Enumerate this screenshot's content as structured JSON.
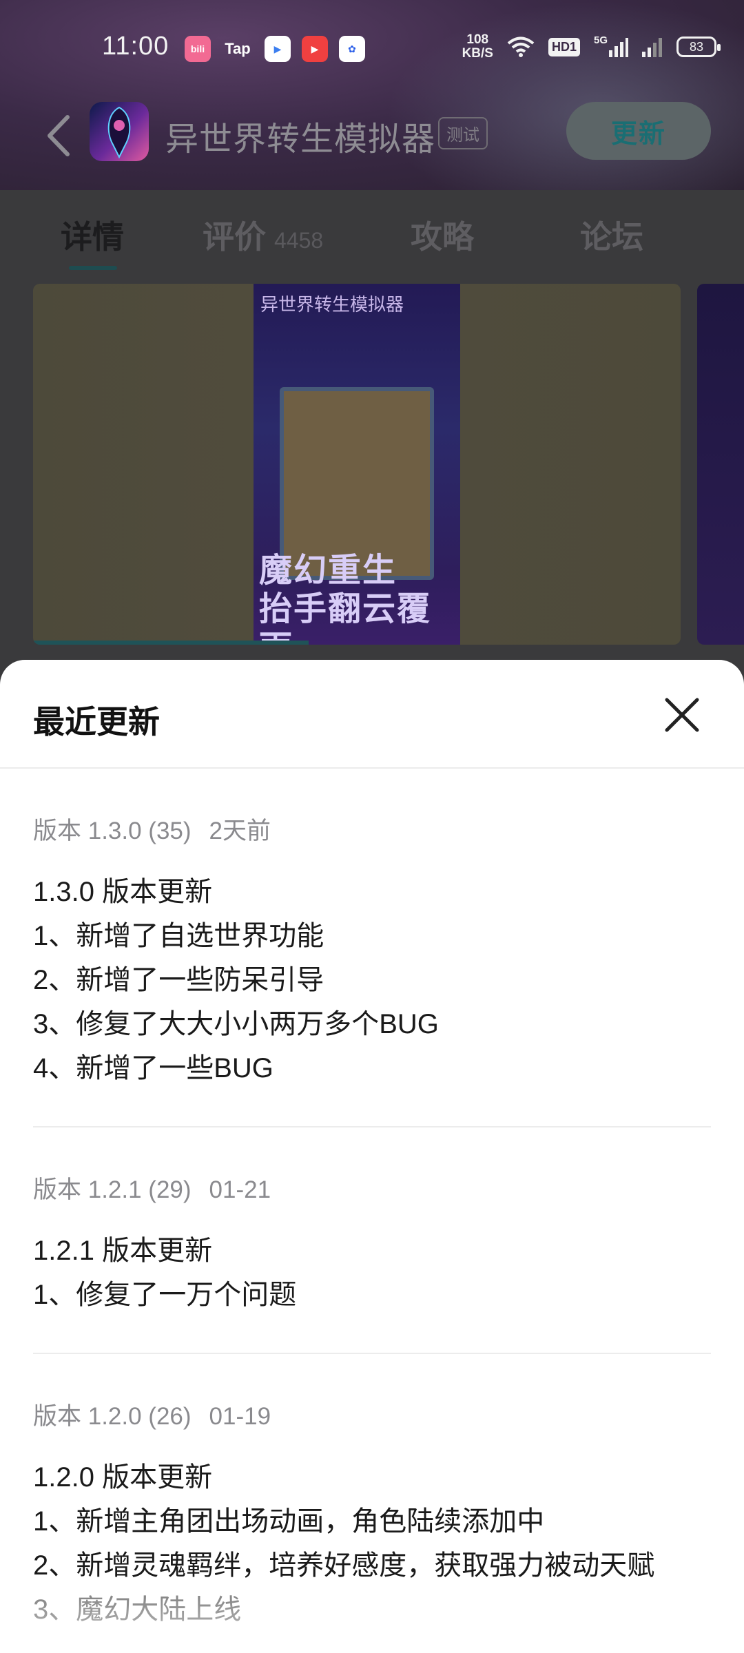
{
  "status_bar": {
    "time": "11:00",
    "net_speed_value": "108",
    "net_speed_unit": "KB/S",
    "hd_label": "HD1",
    "signal_label": "5G",
    "battery": "83",
    "notification_apps": [
      "bilibili",
      "Tap",
      "video-app",
      "play-app",
      "baidu"
    ]
  },
  "header": {
    "app_title": "异世界转生模拟器",
    "badge": "测试",
    "update_button": "更新"
  },
  "tabs": [
    {
      "label": "详情",
      "active": true
    },
    {
      "label": "评价",
      "count": "4458"
    },
    {
      "label": "攻略"
    },
    {
      "label": "论坛"
    }
  ],
  "screenshots": {
    "poster_title": "异世界转生模拟器",
    "poster_slogan_line1": "魔幻重生",
    "poster_slogan_line2": "抬手翻云覆雨"
  },
  "sheet": {
    "title": "最近更新",
    "versions": [
      {
        "version": "版本 1.3.0 (35)",
        "date": "2天前",
        "lines": [
          "1.3.0 版本更新",
          "1、新增了自选世界功能",
          "2、新增了一些防呆引导",
          "3、修复了大大小小两万多个BUG",
          "4、新增了一些BUG"
        ]
      },
      {
        "version": "版本 1.2.1 (29)",
        "date": "01-21",
        "lines": [
          "1.2.1 版本更新",
          "1、修复了一万个问题"
        ]
      },
      {
        "version": "版本 1.2.0 (26)",
        "date": "01-19",
        "lines": [
          "1.2.0 版本更新",
          "1、新增主角团出场动画，角色陆续添加中",
          "2、新增灵魂羁绊，培养好感度，获取强力被动天赋",
          "3、魔幻大陆上线"
        ]
      }
    ]
  },
  "colors": {
    "accent": "#2a9aa2",
    "overlay": "#3a3a3c",
    "sheet_bg": "#ffffff"
  }
}
